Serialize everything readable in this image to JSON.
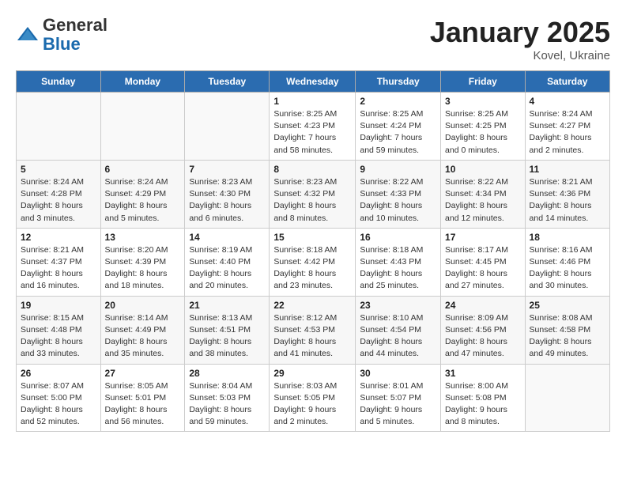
{
  "logo": {
    "general": "General",
    "blue": "Blue"
  },
  "title": "January 2025",
  "location": "Kovel, Ukraine",
  "days_header": [
    "Sunday",
    "Monday",
    "Tuesday",
    "Wednesday",
    "Thursday",
    "Friday",
    "Saturday"
  ],
  "weeks": [
    [
      {
        "day": "",
        "sunrise": "",
        "sunset": "",
        "daylight": ""
      },
      {
        "day": "",
        "sunrise": "",
        "sunset": "",
        "daylight": ""
      },
      {
        "day": "",
        "sunrise": "",
        "sunset": "",
        "daylight": ""
      },
      {
        "day": "1",
        "sunrise": "Sunrise: 8:25 AM",
        "sunset": "Sunset: 4:23 PM",
        "daylight": "Daylight: 7 hours and 58 minutes."
      },
      {
        "day": "2",
        "sunrise": "Sunrise: 8:25 AM",
        "sunset": "Sunset: 4:24 PM",
        "daylight": "Daylight: 7 hours and 59 minutes."
      },
      {
        "day": "3",
        "sunrise": "Sunrise: 8:25 AM",
        "sunset": "Sunset: 4:25 PM",
        "daylight": "Daylight: 8 hours and 0 minutes."
      },
      {
        "day": "4",
        "sunrise": "Sunrise: 8:24 AM",
        "sunset": "Sunset: 4:27 PM",
        "daylight": "Daylight: 8 hours and 2 minutes."
      }
    ],
    [
      {
        "day": "5",
        "sunrise": "Sunrise: 8:24 AM",
        "sunset": "Sunset: 4:28 PM",
        "daylight": "Daylight: 8 hours and 3 minutes."
      },
      {
        "day": "6",
        "sunrise": "Sunrise: 8:24 AM",
        "sunset": "Sunset: 4:29 PM",
        "daylight": "Daylight: 8 hours and 5 minutes."
      },
      {
        "day": "7",
        "sunrise": "Sunrise: 8:23 AM",
        "sunset": "Sunset: 4:30 PM",
        "daylight": "Daylight: 8 hours and 6 minutes."
      },
      {
        "day": "8",
        "sunrise": "Sunrise: 8:23 AM",
        "sunset": "Sunset: 4:32 PM",
        "daylight": "Daylight: 8 hours and 8 minutes."
      },
      {
        "day": "9",
        "sunrise": "Sunrise: 8:22 AM",
        "sunset": "Sunset: 4:33 PM",
        "daylight": "Daylight: 8 hours and 10 minutes."
      },
      {
        "day": "10",
        "sunrise": "Sunrise: 8:22 AM",
        "sunset": "Sunset: 4:34 PM",
        "daylight": "Daylight: 8 hours and 12 minutes."
      },
      {
        "day": "11",
        "sunrise": "Sunrise: 8:21 AM",
        "sunset": "Sunset: 4:36 PM",
        "daylight": "Daylight: 8 hours and 14 minutes."
      }
    ],
    [
      {
        "day": "12",
        "sunrise": "Sunrise: 8:21 AM",
        "sunset": "Sunset: 4:37 PM",
        "daylight": "Daylight: 8 hours and 16 minutes."
      },
      {
        "day": "13",
        "sunrise": "Sunrise: 8:20 AM",
        "sunset": "Sunset: 4:39 PM",
        "daylight": "Daylight: 8 hours and 18 minutes."
      },
      {
        "day": "14",
        "sunrise": "Sunrise: 8:19 AM",
        "sunset": "Sunset: 4:40 PM",
        "daylight": "Daylight: 8 hours and 20 minutes."
      },
      {
        "day": "15",
        "sunrise": "Sunrise: 8:18 AM",
        "sunset": "Sunset: 4:42 PM",
        "daylight": "Daylight: 8 hours and 23 minutes."
      },
      {
        "day": "16",
        "sunrise": "Sunrise: 8:18 AM",
        "sunset": "Sunset: 4:43 PM",
        "daylight": "Daylight: 8 hours and 25 minutes."
      },
      {
        "day": "17",
        "sunrise": "Sunrise: 8:17 AM",
        "sunset": "Sunset: 4:45 PM",
        "daylight": "Daylight: 8 hours and 27 minutes."
      },
      {
        "day": "18",
        "sunrise": "Sunrise: 8:16 AM",
        "sunset": "Sunset: 4:46 PM",
        "daylight": "Daylight: 8 hours and 30 minutes."
      }
    ],
    [
      {
        "day": "19",
        "sunrise": "Sunrise: 8:15 AM",
        "sunset": "Sunset: 4:48 PM",
        "daylight": "Daylight: 8 hours and 33 minutes."
      },
      {
        "day": "20",
        "sunrise": "Sunrise: 8:14 AM",
        "sunset": "Sunset: 4:49 PM",
        "daylight": "Daylight: 8 hours and 35 minutes."
      },
      {
        "day": "21",
        "sunrise": "Sunrise: 8:13 AM",
        "sunset": "Sunset: 4:51 PM",
        "daylight": "Daylight: 8 hours and 38 minutes."
      },
      {
        "day": "22",
        "sunrise": "Sunrise: 8:12 AM",
        "sunset": "Sunset: 4:53 PM",
        "daylight": "Daylight: 8 hours and 41 minutes."
      },
      {
        "day": "23",
        "sunrise": "Sunrise: 8:10 AM",
        "sunset": "Sunset: 4:54 PM",
        "daylight": "Daylight: 8 hours and 44 minutes."
      },
      {
        "day": "24",
        "sunrise": "Sunrise: 8:09 AM",
        "sunset": "Sunset: 4:56 PM",
        "daylight": "Daylight: 8 hours and 47 minutes."
      },
      {
        "day": "25",
        "sunrise": "Sunrise: 8:08 AM",
        "sunset": "Sunset: 4:58 PM",
        "daylight": "Daylight: 8 hours and 49 minutes."
      }
    ],
    [
      {
        "day": "26",
        "sunrise": "Sunrise: 8:07 AM",
        "sunset": "Sunset: 5:00 PM",
        "daylight": "Daylight: 8 hours and 52 minutes."
      },
      {
        "day": "27",
        "sunrise": "Sunrise: 8:05 AM",
        "sunset": "Sunset: 5:01 PM",
        "daylight": "Daylight: 8 hours and 56 minutes."
      },
      {
        "day": "28",
        "sunrise": "Sunrise: 8:04 AM",
        "sunset": "Sunset: 5:03 PM",
        "daylight": "Daylight: 8 hours and 59 minutes."
      },
      {
        "day": "29",
        "sunrise": "Sunrise: 8:03 AM",
        "sunset": "Sunset: 5:05 PM",
        "daylight": "Daylight: 9 hours and 2 minutes."
      },
      {
        "day": "30",
        "sunrise": "Sunrise: 8:01 AM",
        "sunset": "Sunset: 5:07 PM",
        "daylight": "Daylight: 9 hours and 5 minutes."
      },
      {
        "day": "31",
        "sunrise": "Sunrise: 8:00 AM",
        "sunset": "Sunset: 5:08 PM",
        "daylight": "Daylight: 9 hours and 8 minutes."
      },
      {
        "day": "",
        "sunrise": "",
        "sunset": "",
        "daylight": ""
      }
    ]
  ]
}
